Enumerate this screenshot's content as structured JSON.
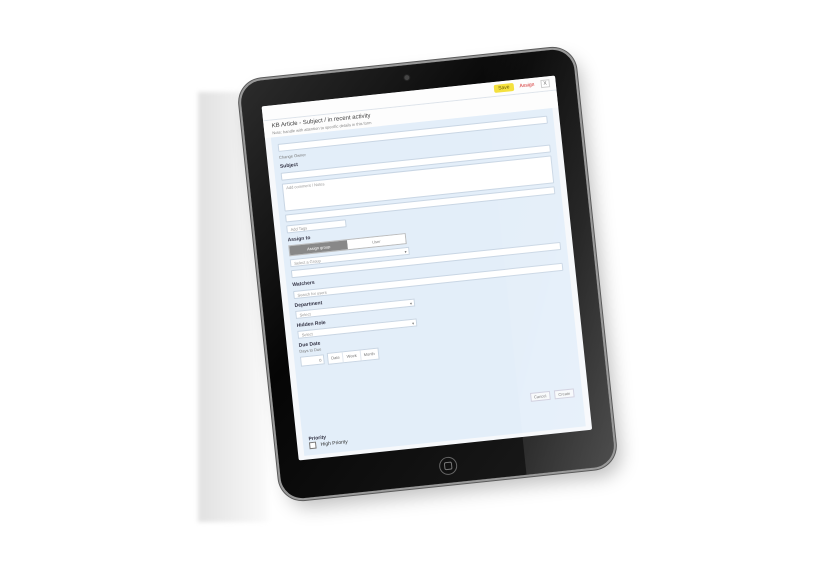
{
  "topbar": {
    "app_name": "",
    "save_label": "Save",
    "assign_label": "Assign",
    "close_label": "X"
  },
  "header": {
    "title": "KB Article - Subject / in recent activity",
    "subtitle": "Note: handle with attention to specific details in this form"
  },
  "form": {
    "change_label": "Change Owner",
    "subject_label": "Subject",
    "subject_value": "",
    "description_placeholder": "Add comment / Notes",
    "tags_placeholder": "Add Tags",
    "assign_to_label": "Assign to",
    "assign_options": [
      "Assign group",
      "User"
    ],
    "assign_select_placeholder": "Select a Group",
    "watchers_label": "Watchers",
    "watchers_placeholder": "Search for users",
    "department_label": "Department",
    "department_value": "Select",
    "hidden_role_label": "Hidden Role",
    "hidden_role_value": "Select",
    "due_date_label": "Due Date",
    "due_date_hint": "Days to Due",
    "due_date_value": "0",
    "date_options": [
      "Date",
      "Week",
      "Month"
    ],
    "cancel_label": "Cancel",
    "create_label": "Create",
    "priority_label": "Priority",
    "high_priority_label": "High Priority"
  }
}
